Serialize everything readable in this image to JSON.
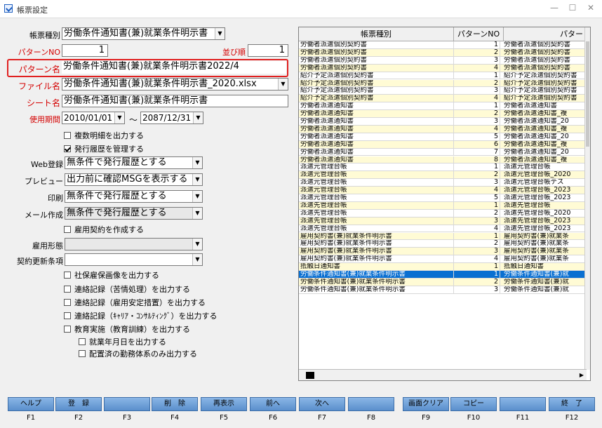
{
  "window": {
    "title": "帳票設定",
    "minimize": "—",
    "maximize": "☐",
    "close": "✕"
  },
  "form": {
    "chohyo_shubetsu_label": "帳票種別",
    "chohyo_shubetsu_value": "労働条件通知書(兼)就業条件明示書",
    "pattern_no_label": "パターンNO",
    "pattern_no_value": "1",
    "narabi_label": "並び順",
    "narabi_value": "1",
    "pattern_name_label": "パターン名",
    "pattern_name_value": "労働条件通知書(兼)就業条件明示書2022/4",
    "file_name_label": "ファイル名",
    "file_name_value": "労働条件通知書(兼)就業条件明示書_2020.xlsx",
    "sheet_name_label": "シート名",
    "sheet_name_value": "労働条件通知書(兼)就業条件明示書",
    "period_label": "使用期間",
    "period_from": "2010/01/01",
    "period_tilde": "〜",
    "period_to": "2087/12/31",
    "chk_fukusu": "複数明細を出力する",
    "chk_hakko": "発行履歴を管理する",
    "web_label": "Web登録",
    "web_value": "無条件で発行履歴とする",
    "preview_label": "プレビュー",
    "preview_value": "出力前に確認MSGを表示する",
    "print_label": "印刷",
    "print_value": "無条件で発行履歴とする",
    "mail_label": "メール作成",
    "mail_value": "無条件で発行履歴とする",
    "chk_koyo": "雇用契約を作成する",
    "koyo_keitai_label": "雇用形態",
    "koyo_keitai_value": "",
    "keiyaku_label": "契約更新条項",
    "keiyaku_value": "",
    "chk_shaho": "社保雇保画像を出力する",
    "chk_renraku1": "連絡記録（苦情処理）を出力する",
    "chk_renraku2": "連絡記録（雇用安定措置）を出力する",
    "chk_renraku3": "連絡記録（ｷｬﾘｱ・ｺﾝｻﾙﾃｨﾝｸﾞ）を出力する",
    "chk_kyoiku": "教育実施（教育訓練）を出力する",
    "chk_shugyo": "就業年月日を出力する",
    "chk_haichi": "配置済の勤務体系のみ出力する"
  },
  "grid": {
    "headers": [
      "帳票種別",
      "パターンNO",
      "パター"
    ],
    "rows": [
      [
        "労働者派遣個別契約書",
        "1",
        "労働者派遣個別契約書"
      ],
      [
        "労働者派遣個別契約書",
        "2",
        "労働者派遣個別契約書"
      ],
      [
        "労働者派遣個別契約書",
        "3",
        "労働者派遣個別契約書"
      ],
      [
        "労働者派遣個別契約書",
        "4",
        "労働者派遣個別契約書"
      ],
      [
        "紹介予定派遣個別契約書",
        "1",
        "紹介予定派遣個別契約書"
      ],
      [
        "紹介予定派遣個別契約書",
        "2",
        "紹介予定派遣個別契約書"
      ],
      [
        "紹介予定派遣個別契約書",
        "3",
        "紹介予定派遣個別契約書"
      ],
      [
        "紹介予定派遣個別契約書",
        "4",
        "紹介予定派遣個別契約書"
      ],
      [
        "労働者派遣通知書",
        "1",
        "労働者派遣通知書"
      ],
      [
        "労働者派遣通知書",
        "2",
        "労働者派遣通知書_複"
      ],
      [
        "労働者派遣通知書",
        "3",
        "労働者派遣通知書_20"
      ],
      [
        "労働者派遣通知書",
        "4",
        "労働者派遣通知書_複"
      ],
      [
        "労働者派遣通知書",
        "5",
        "労働者派遣通知書_20"
      ],
      [
        "労働者派遣通知書",
        "6",
        "労働者派遣通知書_複"
      ],
      [
        "労働者派遣通知書",
        "7",
        "労働者派遣通知書_20"
      ],
      [
        "労働者派遣通知書",
        "8",
        "労働者派遣通知書_複"
      ],
      [
        "派遣元管理台帳",
        "1",
        "派遣元管理台帳"
      ],
      [
        "派遣元管理台帳",
        "2",
        "派遣元管理台帳_2020"
      ],
      [
        "派遣元管理台帳",
        "3",
        "派遣元管理台帳テス"
      ],
      [
        "派遣元管理台帳",
        "4",
        "派遣元管理台帳_2023"
      ],
      [
        "派遣元管理台帳",
        "5",
        "派遣元管理台帳_2023"
      ],
      [
        "派遣先管理台帳",
        "1",
        "派遣先管理台帳"
      ],
      [
        "派遣先管理台帳",
        "2",
        "派遣先管理台帳_2020"
      ],
      [
        "派遣先管理台帳",
        "3",
        "派遣先管理台帳_2023"
      ],
      [
        "派遣先管理台帳",
        "4",
        "派遣先管理台帳_2023"
      ],
      [
        "雇用契約書(兼)就業条件明示書",
        "1",
        "雇用契約書(兼)就業条"
      ],
      [
        "雇用契約書(兼)就業条件明示書",
        "2",
        "雇用契約書(兼)就業条"
      ],
      [
        "雇用契約書(兼)就業条件明示書",
        "3",
        "雇用契約書(兼)就業条"
      ],
      [
        "雇用契約書(兼)就業条件明示書",
        "4",
        "雇用契約書(兼)就業条"
      ],
      [
        "抵触日通知書",
        "1",
        "抵触日通知書"
      ],
      [
        "労働条件通知書(兼)就業条件明示書",
        "1",
        "労働条件通知書(兼)就"
      ],
      [
        "労働条件通知書(兼)就業条件明示書",
        "2",
        "労働条件通知書(兼)就"
      ],
      [
        "労働条件通知書(兼)就業条件明示書",
        "3",
        "労働条件通知書(兼)就"
      ]
    ],
    "selected_row": 30
  },
  "fkeys": {
    "buttons": [
      "ヘルプ",
      "登　録",
      "",
      "削　除",
      "再表示",
      "前へ",
      "次へ",
      "",
      "画面クリア",
      "コピー",
      "",
      "終　了"
    ],
    "keys": [
      "F1",
      "F2",
      "F3",
      "F4",
      "F5",
      "F6",
      "F7",
      "F8",
      "F9",
      "F10",
      "F11",
      "F12"
    ]
  },
  "colors": {
    "highlight": "#e02020",
    "selected_row": "#0a6fd1",
    "alt_row": "#fffbd5",
    "required_label": "#d40000"
  }
}
